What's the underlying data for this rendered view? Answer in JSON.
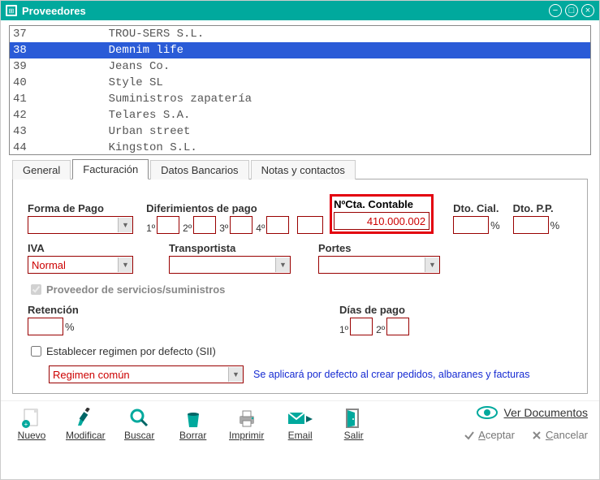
{
  "window": {
    "title": "Proveedores"
  },
  "list": {
    "rows": [
      {
        "id": "37",
        "name": "TROU-SERS S.L.",
        "selected": false
      },
      {
        "id": "38",
        "name": "Demnim life",
        "selected": true
      },
      {
        "id": "39",
        "name": "Jeans Co.",
        "selected": false
      },
      {
        "id": "40",
        "name": "Style SL",
        "selected": false
      },
      {
        "id": "41",
        "name": "Suministros zapatería",
        "selected": false
      },
      {
        "id": "42",
        "name": "Telares S.A.",
        "selected": false
      },
      {
        "id": "43",
        "name": "Urban street",
        "selected": false
      },
      {
        "id": "44",
        "name": "Kingston S.L.",
        "selected": false
      }
    ]
  },
  "tabs": {
    "items": [
      {
        "label": "General",
        "active": false
      },
      {
        "label": "Facturación",
        "active": true
      },
      {
        "label": "Datos Bancarios",
        "active": false
      },
      {
        "label": "Notas y contactos",
        "active": false
      }
    ]
  },
  "form": {
    "forma_pago": {
      "label": "Forma de Pago",
      "value": ""
    },
    "diferimientos": {
      "label": "Diferimientos de pago",
      "ord": [
        "1º",
        "2º",
        "3º",
        "4º"
      ],
      "values": [
        "",
        "",
        "",
        ""
      ],
      "extra": ""
    },
    "cta_contable": {
      "label": "NºCta. Contable",
      "value": "410.000.002"
    },
    "dto_cial": {
      "label": "Dto. Cial.",
      "value": "",
      "suffix": "%"
    },
    "dto_pp": {
      "label": "Dto. P.P.",
      "value": "",
      "suffix": "%"
    },
    "iva": {
      "label": "IVA",
      "value": "Normal"
    },
    "transportista": {
      "label": "Transportista",
      "value": ""
    },
    "portes": {
      "label": "Portes",
      "value": ""
    },
    "proveedor_servicios": {
      "label": "Proveedor de servicios/suministros",
      "checked": true
    },
    "retencion": {
      "label": "Retención",
      "value": "",
      "suffix": "%"
    },
    "dias_pago": {
      "label": "Días de pago",
      "ord": [
        "1º",
        "2º"
      ],
      "values": [
        "",
        ""
      ]
    },
    "sii_check": {
      "label": "Establecer regimen por defecto (SII)",
      "checked": false
    },
    "sii_regimen": {
      "value": "Regimen común"
    },
    "sii_hint": "Se aplicará por defecto al crear pedidos, albaranes y facturas"
  },
  "toolbar": {
    "nuevo": "Nuevo",
    "modificar": "Modificar",
    "buscar": "Buscar",
    "borrar": "Borrar",
    "imprimir": "Imprimir",
    "email": "Email",
    "salir": "Salir",
    "ver_documentos": "Ver Documentos",
    "aceptar": "Aceptar",
    "cancelar": "Cancelar"
  },
  "colors": {
    "accent": "#00a99d",
    "highlight": "#e3000f",
    "link": "#152ad2"
  }
}
